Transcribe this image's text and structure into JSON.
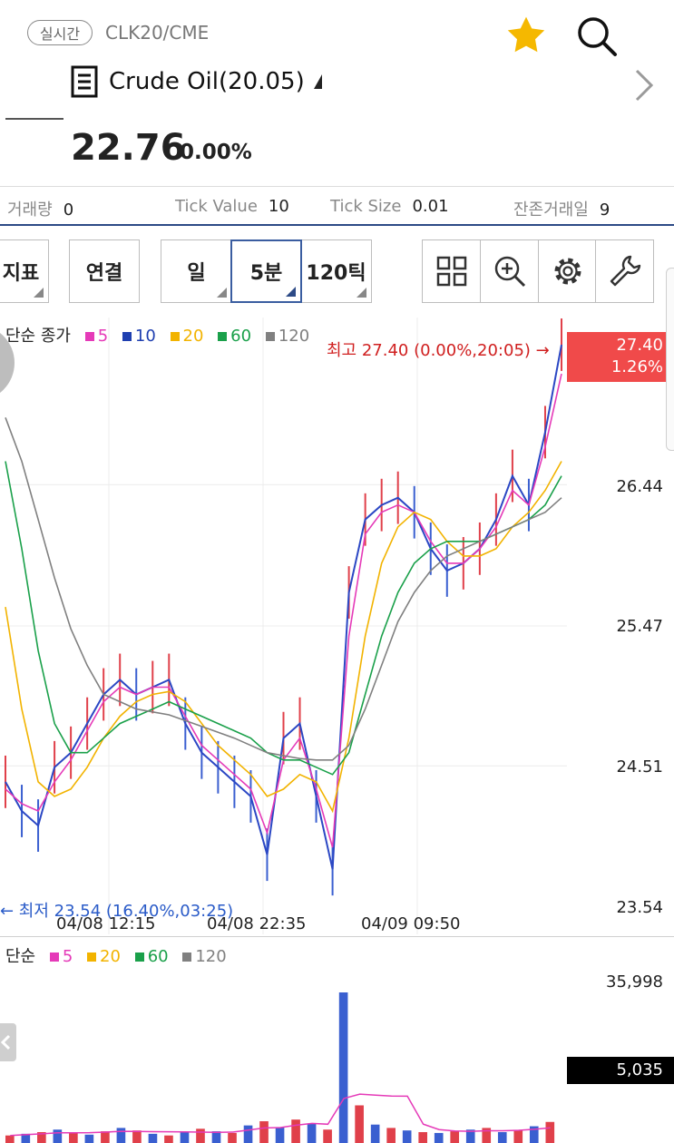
{
  "header": {
    "realtime_badge": "실시간",
    "ticker": "CLK20/CME",
    "title": "Crude Oil(20.05)",
    "price": "22.76",
    "change_pct": "0.00%"
  },
  "info_bar": [
    {
      "key": "거래량",
      "value": "0"
    },
    {
      "key": "Tick Value",
      "value": "10"
    },
    {
      "key": "Tick Size",
      "value": "0.01"
    },
    {
      "key": "잔존거래일",
      "value": "9"
    }
  ],
  "toolbar": {
    "indicator": "지표",
    "link": "연결",
    "day": "일",
    "min5": "5분",
    "tick120": "120틱"
  },
  "price_legend": {
    "label": "단순 종가",
    "items": [
      {
        "name": "5",
        "color": "#e53ab8"
      },
      {
        "name": "10",
        "color": "#1f3fb0"
      },
      {
        "name": "20",
        "color": "#f2b300"
      },
      {
        "name": "60",
        "color": "#1aa04a"
      },
      {
        "name": "120",
        "color": "#808080"
      }
    ]
  },
  "volume_legend": {
    "label": "단순",
    "items": [
      {
        "name": "5",
        "color": "#e53ab8"
      },
      {
        "name": "20",
        "color": "#f2b300"
      },
      {
        "name": "60",
        "color": "#1aa04a"
      },
      {
        "name": "120",
        "color": "#808080"
      }
    ]
  },
  "annotations": {
    "high_note": "최고 27.40 (0.00%,20:05) →",
    "low_note": "← 최저 23.54 (16.40%,03:25)",
    "current_price": "27.40",
    "current_pct": "1.26%",
    "volume_current": "5,035"
  },
  "chart_data": [
    {
      "type": "line",
      "title": "",
      "x_tick_labels": [
        "04/08 12:15",
        "04/08 22:35",
        "04/09 09:50"
      ],
      "y_tick_labels": [
        "26.44",
        "25.47",
        "24.51",
        "23.54"
      ],
      "ylim": [
        23.54,
        27.4
      ],
      "high": 27.4,
      "low": 23.54,
      "series": [
        {
          "name": "close",
          "values": [
            24.4,
            24.2,
            24.1,
            24.5,
            24.6,
            24.8,
            25.0,
            25.1,
            25.0,
            25.05,
            25.1,
            24.8,
            24.6,
            24.5,
            24.4,
            24.3,
            23.9,
            24.7,
            24.8,
            24.3,
            23.8,
            25.7,
            26.2,
            26.3,
            26.35,
            26.25,
            26.0,
            25.85,
            25.9,
            26.0,
            26.2,
            26.5,
            26.3,
            26.8,
            27.4
          ]
        },
        {
          "name": "5",
          "values": [
            24.35,
            24.25,
            24.2,
            24.4,
            24.55,
            24.75,
            24.95,
            25.05,
            25.0,
            25.05,
            25.05,
            24.85,
            24.65,
            24.55,
            24.45,
            24.35,
            24.05,
            24.55,
            24.7,
            24.35,
            23.95,
            25.4,
            26.1,
            26.25,
            26.3,
            26.25,
            26.05,
            25.9,
            25.9,
            26.0,
            26.15,
            26.4,
            26.3,
            26.7,
            27.2
          ]
        },
        {
          "name": "20",
          "values": [
            25.6,
            24.9,
            24.4,
            24.3,
            24.35,
            24.5,
            24.7,
            24.85,
            24.95,
            25.0,
            25.02,
            24.95,
            24.8,
            24.65,
            24.55,
            24.45,
            24.3,
            24.35,
            24.45,
            24.4,
            24.2,
            24.7,
            25.4,
            25.9,
            26.15,
            26.25,
            26.2,
            26.05,
            25.95,
            25.95,
            26.0,
            26.15,
            26.25,
            26.4,
            26.6
          ]
        },
        {
          "name": "60",
          "values": [
            26.6,
            26.0,
            25.3,
            24.8,
            24.6,
            24.6,
            24.7,
            24.8,
            24.85,
            24.9,
            24.95,
            24.9,
            24.85,
            24.8,
            24.75,
            24.7,
            24.6,
            24.55,
            24.55,
            24.5,
            24.45,
            24.6,
            25.0,
            25.4,
            25.7,
            25.9,
            26.0,
            26.05,
            26.05,
            26.05,
            26.1,
            26.15,
            26.2,
            26.3,
            26.5
          ]
        },
        {
          "name": "120",
          "values": [
            26.9,
            26.6,
            26.2,
            25.8,
            25.45,
            25.2,
            25.0,
            24.95,
            24.9,
            24.88,
            24.86,
            24.82,
            24.78,
            24.74,
            24.7,
            24.65,
            24.6,
            24.58,
            24.56,
            24.55,
            24.55,
            24.65,
            24.9,
            25.2,
            25.5,
            25.7,
            25.85,
            25.95,
            26.0,
            26.05,
            26.1,
            26.15,
            26.2,
            26.25,
            26.35
          ]
        }
      ]
    },
    {
      "type": "bar",
      "title": "",
      "y_tick_labels": [
        "35,998"
      ],
      "ylim": [
        0,
        35998
      ],
      "current": 5035,
      "series": [
        {
          "name": "volume",
          "values": [
            1800,
            2200,
            2600,
            3200,
            2400,
            2000,
            2800,
            3600,
            3000,
            2200,
            1800,
            2600,
            3400,
            2800,
            2400,
            4200,
            5200,
            3800,
            5600,
            4600,
            3200,
            35998,
            9000,
            4400,
            3600,
            3000,
            2600,
            2400,
            2800,
            3200,
            3600,
            2600,
            3000,
            4000,
            5035
          ]
        }
      ]
    }
  ]
}
